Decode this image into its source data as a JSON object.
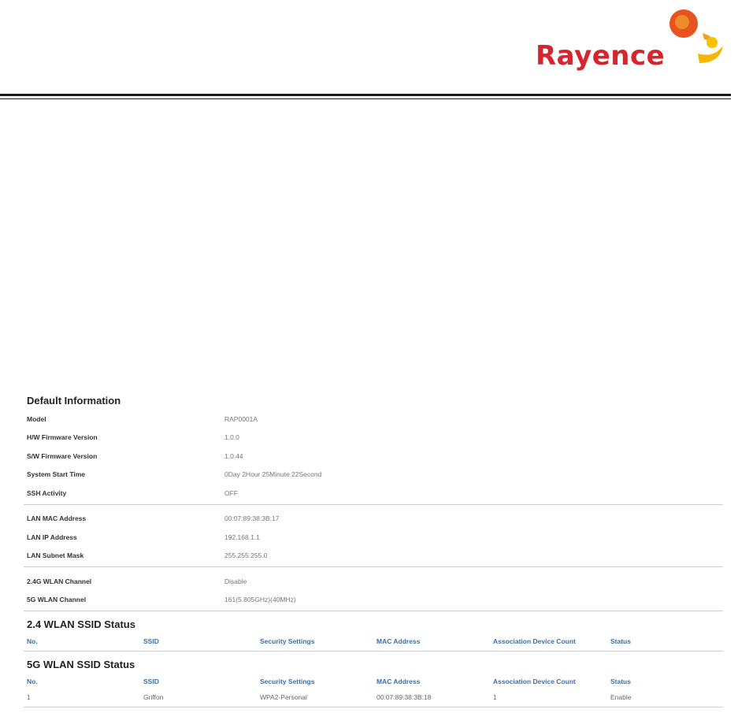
{
  "logo": {
    "text": "Rayence",
    "name": "rayence-logo"
  },
  "default_info": {
    "title": "Default Information",
    "group1": [
      {
        "label": "Model",
        "value": "RAP0001A"
      },
      {
        "label": "H/W Firmware Version",
        "value": "1.0.0"
      },
      {
        "label": "S/W Firmware Version",
        "value": "1.0.44"
      },
      {
        "label": "System Start Time",
        "value": "0Day 2Hour 25Minute 22Second"
      },
      {
        "label": "SSH Activity",
        "value": "OFF"
      }
    ],
    "group2": [
      {
        "label": "LAN MAC Address",
        "value": "00:07:89:38:3B:17"
      },
      {
        "label": "LAN IP Address",
        "value": "192.168.1.1"
      },
      {
        "label": "LAN Subnet Mask",
        "value": "255.255.255.0"
      }
    ],
    "group3": [
      {
        "label": "2.4G WLAN Channel",
        "value": "Disable"
      },
      {
        "label": "5G WLAN Channel",
        "value": "161(5.805GHz)(40MHz)"
      }
    ]
  },
  "wlan24": {
    "title": "2.4 WLAN SSID Status",
    "columns": [
      "No.",
      "SSID",
      "Security Settings",
      "MAC Address",
      "Association Device Count",
      "Status"
    ],
    "rows": []
  },
  "wlan5": {
    "title": "5G WLAN SSID Status",
    "columns": [
      "No.",
      "SSID",
      "Security Settings",
      "MAC Address",
      "Association Device Count",
      "Status"
    ],
    "rows": [
      [
        "1",
        "Griffon",
        "WPA2-Personal",
        "00:07:89:38:3B:18",
        "1",
        "Enable"
      ]
    ]
  }
}
